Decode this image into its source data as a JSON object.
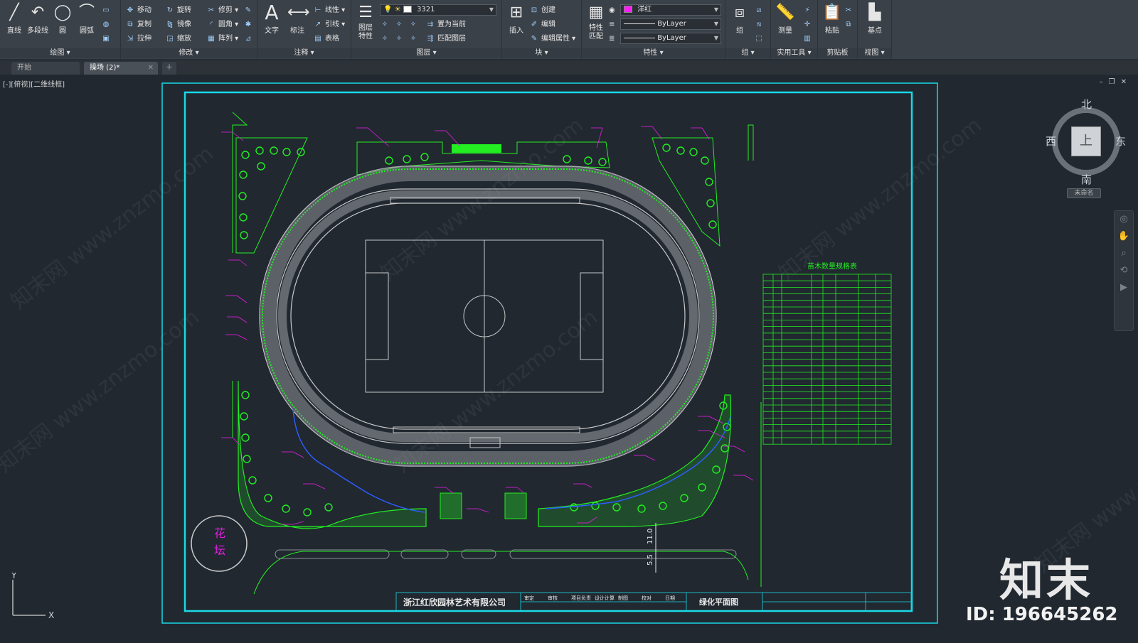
{
  "ribbon": {
    "draw": {
      "title": "绘图",
      "line": "直线",
      "polyline": "多段线",
      "circle": "圆",
      "arc": "圆弧"
    },
    "modify": {
      "title": "修改",
      "move": "移动",
      "rotate": "旋转",
      "trim": "修剪",
      "copy": "复制",
      "mirror": "镜像",
      "fillet": "圆角",
      "stretch": "拉伸",
      "scale": "缩放",
      "array": "阵列"
    },
    "annotation": {
      "title": "注释",
      "text": "文字",
      "dimension": "标注",
      "linear": "线性",
      "leader": "引线",
      "table": "表格"
    },
    "layers": {
      "title": "图层",
      "layer_props": "图层特性",
      "current_layer": "3321",
      "set_current": "置为当前",
      "match_layer": "匹配图层"
    },
    "block": {
      "title": "块",
      "insert": "插入",
      "create": "创建",
      "edit": "编辑",
      "edit_attr": "编辑属性"
    },
    "properties": {
      "title": "特性",
      "match": "特性匹配",
      "color": "洋红",
      "linetype": "ByLayer",
      "lineweight": "ByLayer"
    },
    "groups": {
      "title": "组",
      "group": "组"
    },
    "utilities": {
      "title": "实用工具",
      "measure": "测量"
    },
    "clipboard": {
      "title": "剪贴板",
      "paste": "粘贴"
    },
    "view": {
      "title": "视图",
      "base": "基点"
    }
  },
  "tabs": [
    {
      "label": "开始"
    },
    {
      "label": "操场 (2)*"
    }
  ],
  "viewport": {
    "label": "[-][俯视][二维线框]"
  },
  "viewcube": {
    "north": "北",
    "south": "南",
    "east": "东",
    "west": "西",
    "face": "上",
    "unnamed": "未命名"
  },
  "drawing": {
    "company": "浙江红欣园林艺术有限公司",
    "sheet_title": "绿化平面图",
    "table_title": "苗木数量规格表",
    "flower_bed": [
      "花",
      "坛"
    ],
    "title_block_cols": [
      "审定",
      "审核",
      "项目负责",
      "设计计算",
      "制图",
      "校对",
      "日期"
    ],
    "dims": [
      "11.0",
      "5.5"
    ]
  },
  "watermark": {
    "brand": "知末",
    "id": "ID: 196645262",
    "site": "知末网 www.znzmo.com"
  },
  "ucs": {
    "x": "X",
    "y": "Y"
  },
  "colors": {
    "cyan": "#19d9e5",
    "green": "#22ee22",
    "magenta": "#e61ee6",
    "grey": "#c8c8c8",
    "bg": "#212830"
  }
}
